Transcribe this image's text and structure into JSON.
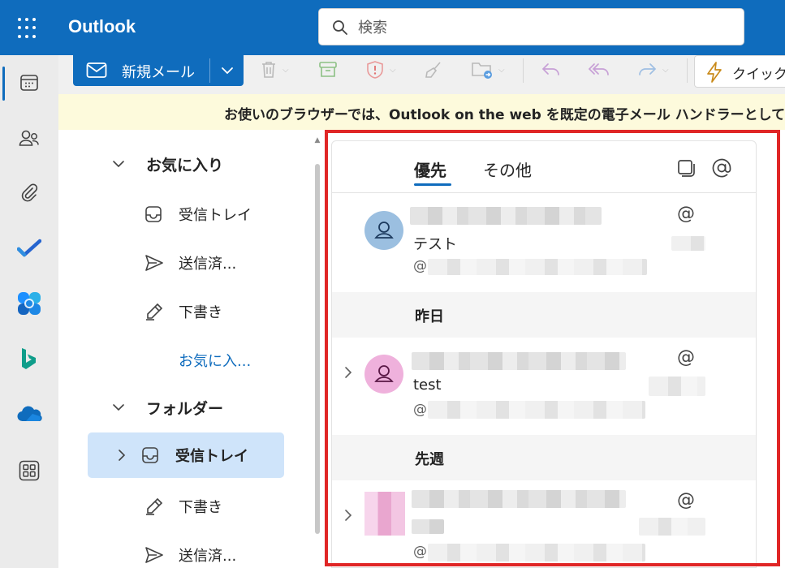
{
  "app": {
    "title": "Outlook"
  },
  "search": {
    "placeholder": "検索"
  },
  "rail": {
    "items": [
      {
        "name": "calendar-icon"
      },
      {
        "name": "people-icon"
      },
      {
        "name": "attachment-icon"
      },
      {
        "name": "todo-icon"
      },
      {
        "name": "copilot-icon"
      },
      {
        "name": "bing-icon"
      },
      {
        "name": "onedrive-icon"
      },
      {
        "name": "more-apps-icon"
      }
    ]
  },
  "ribbon": {
    "new_mail_label": "新規メール",
    "quick_steps_label": "クイック操作"
  },
  "banner": {
    "text": "お使いのブラウザーでは、Outlook on the web を既定の電子メール ハンドラーとして"
  },
  "folders": {
    "favorites_header": "お気に入り",
    "favorites": [
      {
        "label": "受信トレイ",
        "icon": "inbox-icon"
      },
      {
        "label": "送信済...",
        "icon": "send-icon"
      },
      {
        "label": "下書き",
        "icon": "draft-icon"
      },
      {
        "label": "お気に入...",
        "icon": ""
      }
    ],
    "folders_header": "フォルダー",
    "folders": [
      {
        "label": "受信トレイ",
        "icon": "inbox-icon",
        "selected": true
      },
      {
        "label": "下書き",
        "icon": "draft-icon"
      },
      {
        "label": "送信済...",
        "icon": "send-icon"
      }
    ]
  },
  "mail_list": {
    "tabs": [
      {
        "label": "優先",
        "active": true
      },
      {
        "label": "その他",
        "active": false
      }
    ],
    "groups": [
      "昨日",
      "先週"
    ],
    "messages": [
      {
        "subject": "テスト",
        "preview": "@",
        "mention": "@"
      },
      {
        "subject": "test",
        "preview": "@",
        "mention": "@"
      },
      {
        "subject": "",
        "preview": "@",
        "mention": "@"
      }
    ]
  },
  "colors": {
    "brand": "#0f6cbd",
    "highlight_frame": "#e02626",
    "banner_bg": "#fdfadc",
    "selected_folder": "#cfe4fa"
  }
}
